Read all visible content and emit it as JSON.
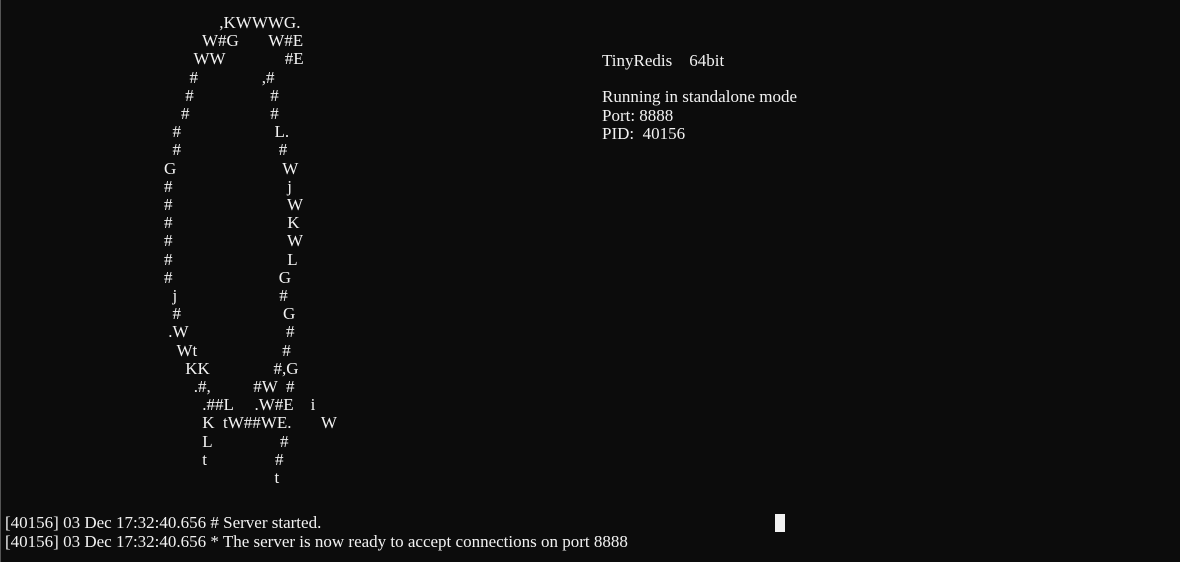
{
  "ascii_logo": "             ,KWWWG.\n         W#G       W#E\n       WW              #E\n      #               ,#\n     #                  #\n    #                   #\n  #                      L.\n  #                       #\nG                         W\n#                           j\n#                           W\n#                           K\n#                           W\n#                           L\n#                         G\n  j                        #\n  #                        G\n .W                       #\n   Wt                    #\n     KK               #,G\n       .#,          #W  #\n         .##L     .W#E    i\n         K  tW##WE.       W\n         L                #\n         t                #\n                          t",
  "info": {
    "title": "TinyRedis    64bit",
    "mode": "Running in standalone mode",
    "port": "Port: 8888",
    "pid": "PID:  40156"
  },
  "log": [
    "[40156] 03 Dec 17:32:40.656 # Server started.",
    "[40156] 03 Dec 17:32:40.656 * The server is now ready to accept connections on port 8888"
  ]
}
